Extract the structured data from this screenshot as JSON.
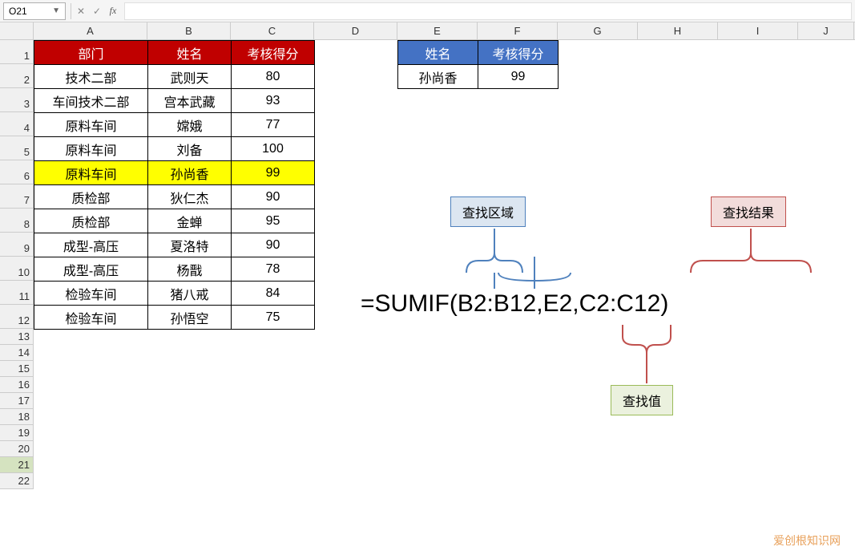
{
  "nameBox": "O21",
  "formulaInput": "",
  "columns": [
    "A",
    "B",
    "C",
    "D",
    "E",
    "F",
    "G",
    "H",
    "I",
    "J"
  ],
  "rows": [
    "1",
    "2",
    "3",
    "4",
    "5",
    "6",
    "7",
    "8",
    "9",
    "10",
    "11",
    "12",
    "13",
    "14",
    "15",
    "16",
    "17",
    "18",
    "19",
    "20",
    "21",
    "22"
  ],
  "table1": {
    "headers": {
      "A": "部门",
      "B": "姓名",
      "C": "考核得分"
    },
    "rows": [
      {
        "A": "技术二部",
        "B": "武则天",
        "C": "80"
      },
      {
        "A": "车间技术二部",
        "B": "宫本武藏",
        "C": "93"
      },
      {
        "A": "原料车间",
        "B": "嫦娥",
        "C": "77"
      },
      {
        "A": "原料车间",
        "B": "刘备",
        "C": "100"
      },
      {
        "A": "原料车间",
        "B": "孙尚香",
        "C": "99",
        "highlight": true
      },
      {
        "A": "质检部",
        "B": "狄仁杰",
        "C": "90"
      },
      {
        "A": "质检部",
        "B": "金蝉",
        "C": "95"
      },
      {
        "A": "成型-高压",
        "B": "夏洛特",
        "C": "90"
      },
      {
        "A": "成型-高压",
        "B": "杨戬",
        "C": "78"
      },
      {
        "A": "检验车间",
        "B": "猪八戒",
        "C": "84"
      },
      {
        "A": "检验车间",
        "B": "孙悟空",
        "C": "75"
      }
    ]
  },
  "table2": {
    "headers": {
      "E": "姓名",
      "F": "考核得分"
    },
    "row": {
      "E": "孙尚香",
      "F": "99"
    }
  },
  "formulaText": "=SUMIF(B2:B12,E2,C2:C12)",
  "callouts": {
    "lookupRange": "查找区域",
    "lookupResult": "查找结果",
    "lookupValue": "查找值"
  },
  "buttons": {
    "cancel": "✕",
    "confirm": "✓",
    "fx": "fx"
  },
  "watermark": "爱创根知识网"
}
